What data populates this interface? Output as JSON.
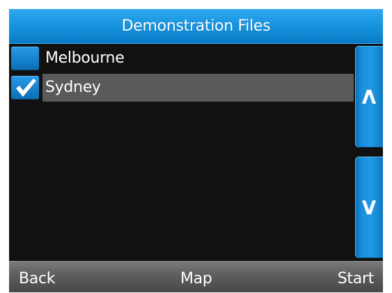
{
  "header": {
    "title": "Demonstration Files"
  },
  "file_list": {
    "items": [
      {
        "label": "Melbourne",
        "checked": false,
        "selected": false
      },
      {
        "label": "Sydney",
        "checked": true,
        "selected": true
      }
    ]
  },
  "scroll": {
    "up_icon": "chevron-up-icon",
    "down_icon": "chevron-down-icon"
  },
  "softkeys": {
    "back_label": "Back",
    "map_label": "Map",
    "start_label": "Start"
  },
  "colors": {
    "accent_blue": "#1591dc",
    "background": "#111111",
    "selected_row": "#5a5a5a",
    "softkey_bar": "#5d5d5d"
  }
}
